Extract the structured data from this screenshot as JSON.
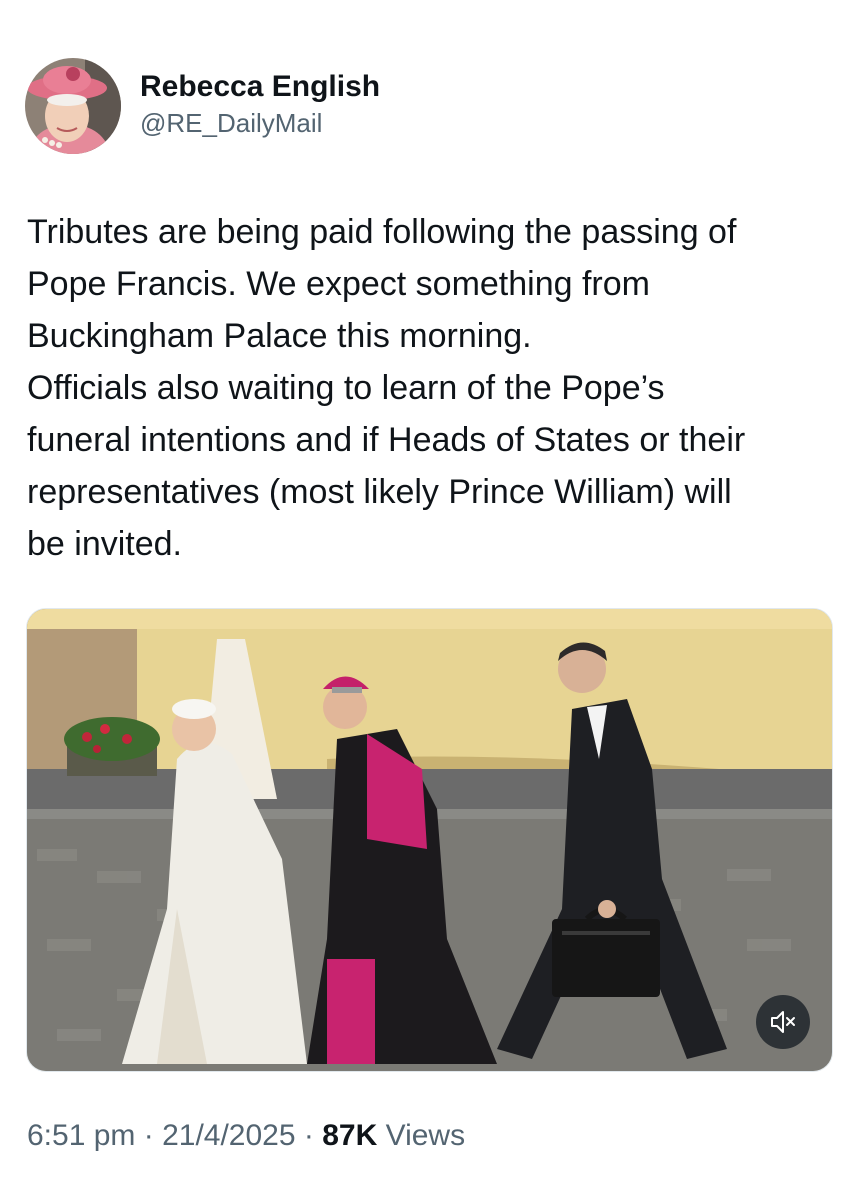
{
  "author": {
    "display_name": "Rebecca English",
    "handle": "@RE_DailyMail",
    "avatar_icon": "avatar-photo-queen-pink-hat"
  },
  "tweet": {
    "lines": [
      "Tributes are being paid following the passing of",
      "Pope Francis. We expect something from",
      "Buckingham Palace this morning.",
      "Officials also waiting to learn of the Pope’s",
      "funeral intentions and if Heads of States or their",
      "representatives (most likely Prince William) will",
      "be invited."
    ]
  },
  "media": {
    "type": "video",
    "mute_icon": "speaker-muted-icon"
  },
  "meta": {
    "time": "6:51 pm",
    "separator": " · ",
    "date": "21/4/2025",
    "views_count": "87K",
    "views_label": " Views"
  },
  "colors": {
    "text_primary": "#0f1419",
    "text_secondary": "#536471"
  }
}
